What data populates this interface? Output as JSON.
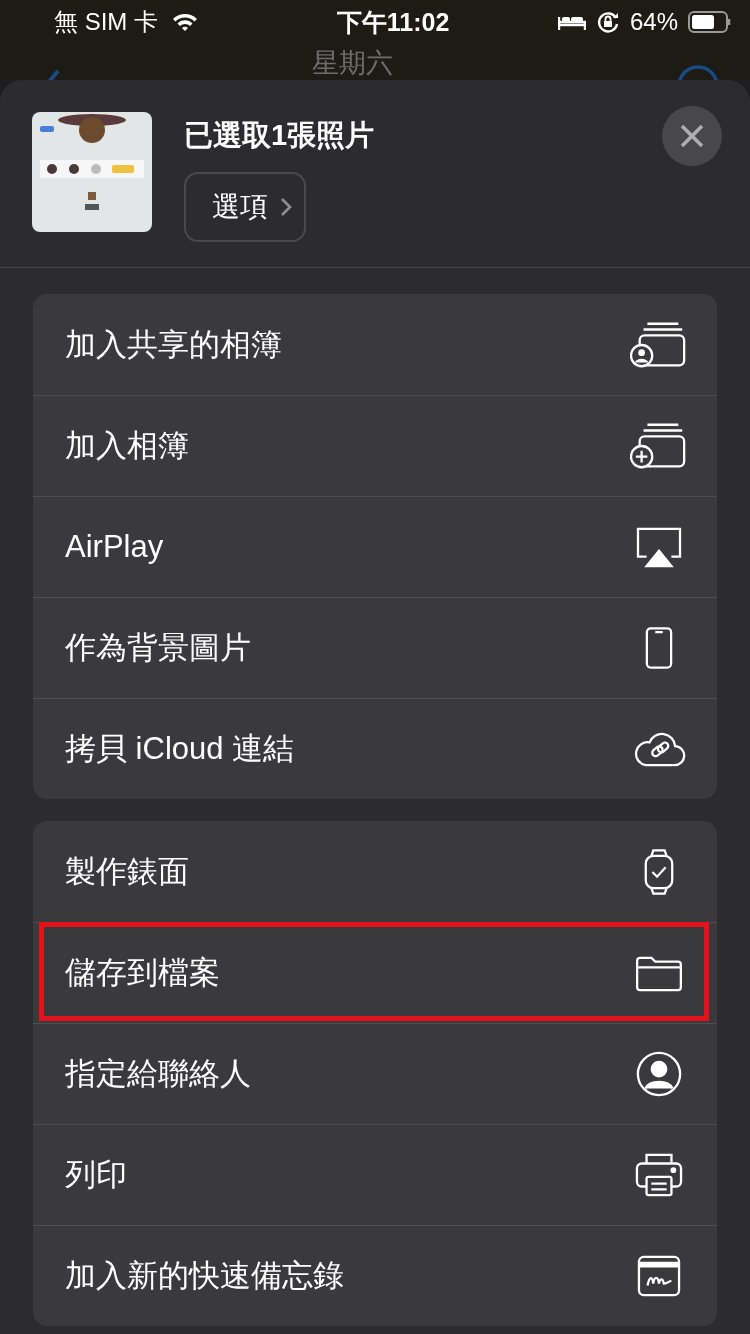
{
  "status_bar": {
    "carrier": "無 SIM 卡",
    "time": "下午11:02",
    "battery": "64%"
  },
  "nav_behind": {
    "title": "星期六"
  },
  "header": {
    "title": "已選取1張照片",
    "options_button": "選項"
  },
  "groups": [
    {
      "actions": [
        {
          "label": "加入共享的相簿",
          "kind": "shared-album",
          "highlighted": false
        },
        {
          "label": "加入相簿",
          "kind": "add-album",
          "highlighted": false
        },
        {
          "label": "AirPlay",
          "kind": "airplay",
          "highlighted": false
        },
        {
          "label": "作為背景圖片",
          "kind": "phone",
          "highlighted": false
        },
        {
          "label": "拷貝 iCloud 連結",
          "kind": "cloud-link",
          "highlighted": false
        }
      ]
    },
    {
      "actions": [
        {
          "label": "製作錶面",
          "kind": "watch",
          "highlighted": false
        },
        {
          "label": "儲存到檔案",
          "kind": "folder",
          "highlighted": true
        },
        {
          "label": "指定給聯絡人",
          "kind": "contact",
          "highlighted": false
        },
        {
          "label": "列印",
          "kind": "printer",
          "highlighted": false
        },
        {
          "label": "加入新的快速備忘錄",
          "kind": "quick-note",
          "highlighted": false
        }
      ]
    }
  ]
}
